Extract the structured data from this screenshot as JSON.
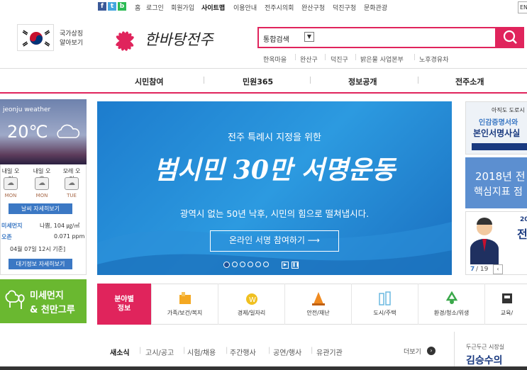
{
  "top": {
    "sns": [
      {
        "label": "f",
        "color": "#3b5998"
      },
      {
        "label": "t",
        "color": "#45a6df"
      },
      {
        "label": "b",
        "color": "#2dbb55"
      }
    ],
    "links": [
      "홈",
      "로그인",
      "회원가입",
      "사이트맵",
      "이용안내",
      "전주시의회",
      "완산구청",
      "덕진구청",
      "문화관광"
    ],
    "lang": "EN"
  },
  "header": {
    "symbol_text_1": "국가상징",
    "symbol_text_2": "알아보기",
    "logo_text": "한바탕전주",
    "search_select": "통합검색",
    "quick_links": [
      "한옥마을",
      "완산구",
      "덕진구",
      "밝은물 사업본부",
      "노후경유차"
    ]
  },
  "nav": [
    "시민참여",
    "민원365",
    "정보공개",
    "전주소개"
  ],
  "weather": {
    "title": "jeonju weather",
    "temp": "20℃",
    "days": [
      {
        "when": "내일 오전",
        "label": "MON"
      },
      {
        "when": "내일 오후",
        "label": "MON"
      },
      {
        "when": "모레 오전",
        "label": "TUE"
      }
    ],
    "detail_button": "날씨 자세히보기",
    "dust_label": "미세먼지",
    "dust_value": "나쁨, 104 ㎍/㎥",
    "ozone_label": "오존",
    "ozone_value": "0.071 ppm",
    "time": "04월 07일 12시 기준]",
    "air_button": "대기정보 자세히보기"
  },
  "dust_banner": {
    "line1": "미세먼지",
    "line2": "& 천만그루"
  },
  "banner": {
    "subtitle": "전주 특례시 지정을 위한",
    "title": "범시민 30만 서명운동",
    "desc": "광역시 없는 50년 낙후, 시민의 힘으로 떨쳐냅시다.",
    "button": "온라인 서명 참여하기 ⟶",
    "dots": [
      "1",
      "2",
      "3",
      "4",
      "5",
      "6"
    ]
  },
  "right": {
    "r1_top": "아직도 도로시",
    "r1_mid": "인감증명서와",
    "r1_main": "본인서명사실",
    "r2_line1": "2018년 전",
    "r2_line2": "핵심지표 점",
    "r3_main": "전",
    "r3_small": "20",
    "page_current": "7",
    "page_total": "/ 19"
  },
  "categories": {
    "label_1": "분야별",
    "label_2": "정보",
    "items": [
      {
        "label": "가족/보건/복지",
        "color": "#f4a822"
      },
      {
        "label": "경제/일자리",
        "color": "#f0c020"
      },
      {
        "label": "안전/재난",
        "color": "#f08a20"
      },
      {
        "label": "도시/주택",
        "color": "#6ab8e0"
      },
      {
        "label": "환경/청소/위생",
        "color": "#3aa84a"
      },
      {
        "label": "교육/",
        "color": "#333333"
      }
    ]
  },
  "news": {
    "tabs": [
      "새소식",
      "고시/공고",
      "시험/채용",
      "주간행사",
      "공연/행사",
      "유관기관"
    ],
    "more": "더보기",
    "mayor_small": "두근두근 시장실",
    "mayor_name": "김승수의"
  }
}
